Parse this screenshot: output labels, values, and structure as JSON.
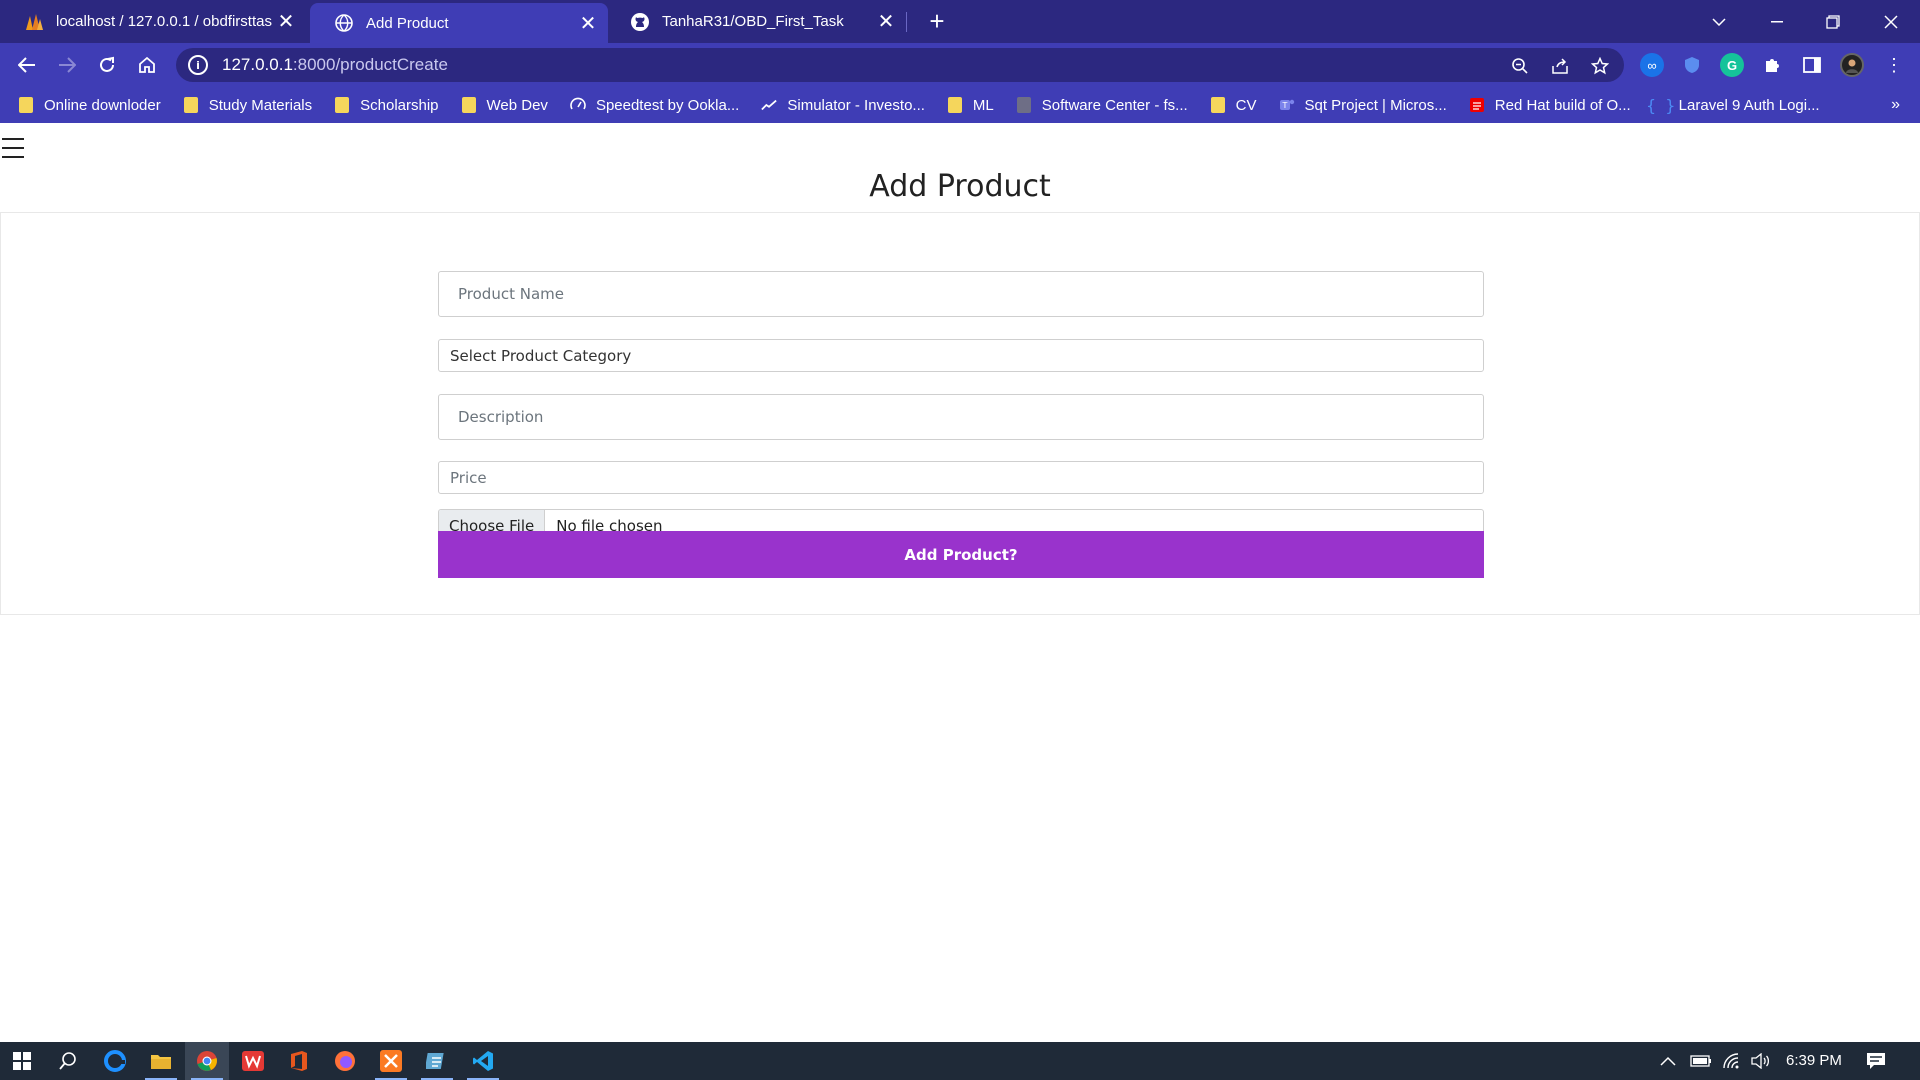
{
  "browser": {
    "tabs": [
      {
        "title": "localhost / 127.0.0.1 / obdfirsttas",
        "icon": "phpmyadmin-icon"
      },
      {
        "title": "Add Product",
        "icon": "globe-icon"
      },
      {
        "title": "TanhaR31/OBD_First_Task",
        "icon": "github-icon"
      }
    ],
    "url_host": "127.0.0.1",
    "url_rest": ":8000/productCreate",
    "bookmarks": [
      {
        "label": "Online downloder",
        "icon": "folder-icon"
      },
      {
        "label": "Study Materials",
        "icon": "folder-icon"
      },
      {
        "label": "Scholarship",
        "icon": "folder-icon"
      },
      {
        "label": "Web Dev",
        "icon": "folder-icon"
      },
      {
        "label": "Speedtest by Ookla...",
        "icon": "speedtest-icon"
      },
      {
        "label": "Simulator - Investo...",
        "icon": "investopedia-icon"
      },
      {
        "label": "ML",
        "icon": "folder-icon"
      },
      {
        "label": "Software Center - fs...",
        "icon": "folder-gray-icon"
      },
      {
        "label": "CV",
        "icon": "folder-icon"
      },
      {
        "label": "Sqt Project | Micros...",
        "icon": "teams-icon"
      },
      {
        "label": "Red Hat build of O...",
        "icon": "redhat-icon"
      },
      {
        "label": "Laravel 9 Auth Logi...",
        "icon": "braces-icon"
      }
    ],
    "bookmarks_more": "»"
  },
  "page": {
    "title": "Add Product",
    "form": {
      "product_name_placeholder": "Product Name",
      "category_selected": "Select Product Category",
      "description_placeholder": "Description",
      "price_placeholder": "Price",
      "file_button": "Choose File",
      "file_status": "No file chosen",
      "submit_label": "Add Product?"
    }
  },
  "taskbar": {
    "clock": "6:39 PM"
  },
  "colors": {
    "browser_dark": "#2c2880",
    "browser_light": "#3f3db5",
    "submit_button": "#9933cc",
    "taskbar": "#1f2a38"
  }
}
